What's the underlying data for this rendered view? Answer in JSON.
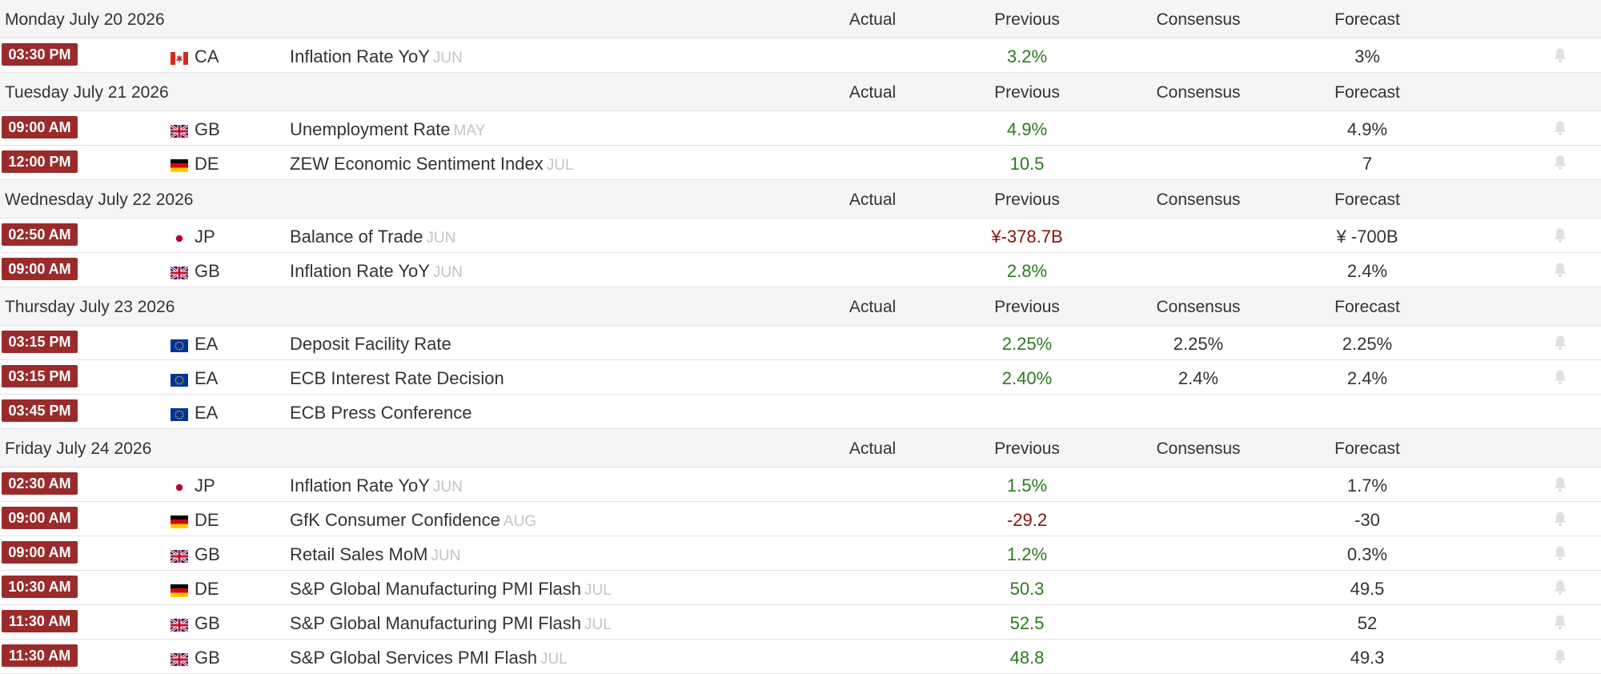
{
  "columns": {
    "actual": "Actual",
    "previous": "Previous",
    "consensus": "Consensus",
    "forecast": "Forecast"
  },
  "colors": {
    "time_badge": "#9b2b2b",
    "positive": "#2c7a1d",
    "negative": "#8b1010",
    "reference": "#c4c4c4",
    "bell": "#e0e0e0"
  },
  "days": [
    {
      "date": "Monday July 20 2026",
      "events": [
        {
          "time": "03:30 PM",
          "flag": "flag-ca-icon",
          "country": "CA",
          "name": "Inflation Rate YoY",
          "ref": "JUN",
          "actual": "",
          "previous": "3.2%",
          "previous_trend": "pos",
          "consensus": "",
          "forecast": "3%",
          "alert": true
        }
      ]
    },
    {
      "date": "Tuesday July 21 2026",
      "events": [
        {
          "time": "09:00 AM",
          "flag": "flag-gb-icon",
          "country": "GB",
          "name": "Unemployment Rate",
          "ref": "MAY",
          "actual": "",
          "previous": "4.9%",
          "previous_trend": "pos",
          "consensus": "",
          "forecast": "4.9%",
          "alert": true
        },
        {
          "time": "12:00 PM",
          "flag": "flag-de-icon",
          "country": "DE",
          "name": "ZEW Economic Sentiment Index",
          "ref": "JUL",
          "actual": "",
          "previous": "10.5",
          "previous_trend": "pos",
          "consensus": "",
          "forecast": "7",
          "alert": true
        }
      ]
    },
    {
      "date": "Wednesday July 22 2026",
      "events": [
        {
          "time": "02:50 AM",
          "flag": "flag-jp-icon",
          "country": "JP",
          "name": "Balance of Trade",
          "ref": "JUN",
          "actual": "",
          "previous": "¥-378.7B",
          "previous_trend": "neg",
          "consensus": "",
          "forecast": "¥ -700B",
          "alert": true
        },
        {
          "time": "09:00 AM",
          "flag": "flag-gb-icon",
          "country": "GB",
          "name": "Inflation Rate YoY",
          "ref": "JUN",
          "actual": "",
          "previous": "2.8%",
          "previous_trend": "pos",
          "consensus": "",
          "forecast": "2.4%",
          "alert": true
        }
      ]
    },
    {
      "date": "Thursday July 23 2026",
      "events": [
        {
          "time": "03:15 PM",
          "flag": "flag-eu-icon",
          "country": "EA",
          "name": "Deposit Facility Rate",
          "ref": "",
          "actual": "",
          "previous": "2.25%",
          "previous_trend": "pos",
          "consensus": "2.25%",
          "forecast": "2.25%",
          "alert": true
        },
        {
          "time": "03:15 PM",
          "flag": "flag-eu-icon",
          "country": "EA",
          "name": "ECB Interest Rate Decision",
          "ref": "",
          "actual": "",
          "previous": "2.40%",
          "previous_trend": "pos",
          "consensus": "2.4%",
          "forecast": "2.4%",
          "alert": true
        },
        {
          "time": "03:45 PM",
          "flag": "flag-eu-icon",
          "country": "EA",
          "name": "ECB Press Conference",
          "ref": "",
          "actual": "",
          "previous": "",
          "previous_trend": "",
          "consensus": "",
          "forecast": "",
          "alert": false
        }
      ]
    },
    {
      "date": "Friday July 24 2026",
      "events": [
        {
          "time": "02:30 AM",
          "flag": "flag-jp-icon",
          "country": "JP",
          "name": "Inflation Rate YoY",
          "ref": "JUN",
          "actual": "",
          "previous": "1.5%",
          "previous_trend": "pos",
          "consensus": "",
          "forecast": "1.7%",
          "alert": true
        },
        {
          "time": "09:00 AM",
          "flag": "flag-de-icon",
          "country": "DE",
          "name": "GfK Consumer Confidence",
          "ref": "AUG",
          "actual": "",
          "previous": "-29.2",
          "previous_trend": "neg",
          "consensus": "",
          "forecast": "-30",
          "alert": true
        },
        {
          "time": "09:00 AM",
          "flag": "flag-gb-icon",
          "country": "GB",
          "name": "Retail Sales MoM",
          "ref": "JUN",
          "actual": "",
          "previous": "1.2%",
          "previous_trend": "pos",
          "consensus": "",
          "forecast": "0.3%",
          "alert": true
        },
        {
          "time": "10:30 AM",
          "flag": "flag-de-icon",
          "country": "DE",
          "name": "S&P Global Manufacturing PMI Flash",
          "ref": "JUL",
          "actual": "",
          "previous": "50.3",
          "previous_trend": "pos",
          "consensus": "",
          "forecast": "49.5",
          "alert": true
        },
        {
          "time": "11:30 AM",
          "flag": "flag-gb-icon",
          "country": "GB",
          "name": "S&P Global Manufacturing PMI Flash",
          "ref": "JUL",
          "actual": "",
          "previous": "52.5",
          "previous_trend": "pos",
          "consensus": "",
          "forecast": "52",
          "alert": true
        },
        {
          "time": "11:30 AM",
          "flag": "flag-gb-icon",
          "country": "GB",
          "name": "S&P Global Services PMI Flash",
          "ref": "JUL",
          "actual": "",
          "previous": "48.8",
          "previous_trend": "pos",
          "consensus": "",
          "forecast": "49.3",
          "alert": true
        }
      ]
    }
  ]
}
